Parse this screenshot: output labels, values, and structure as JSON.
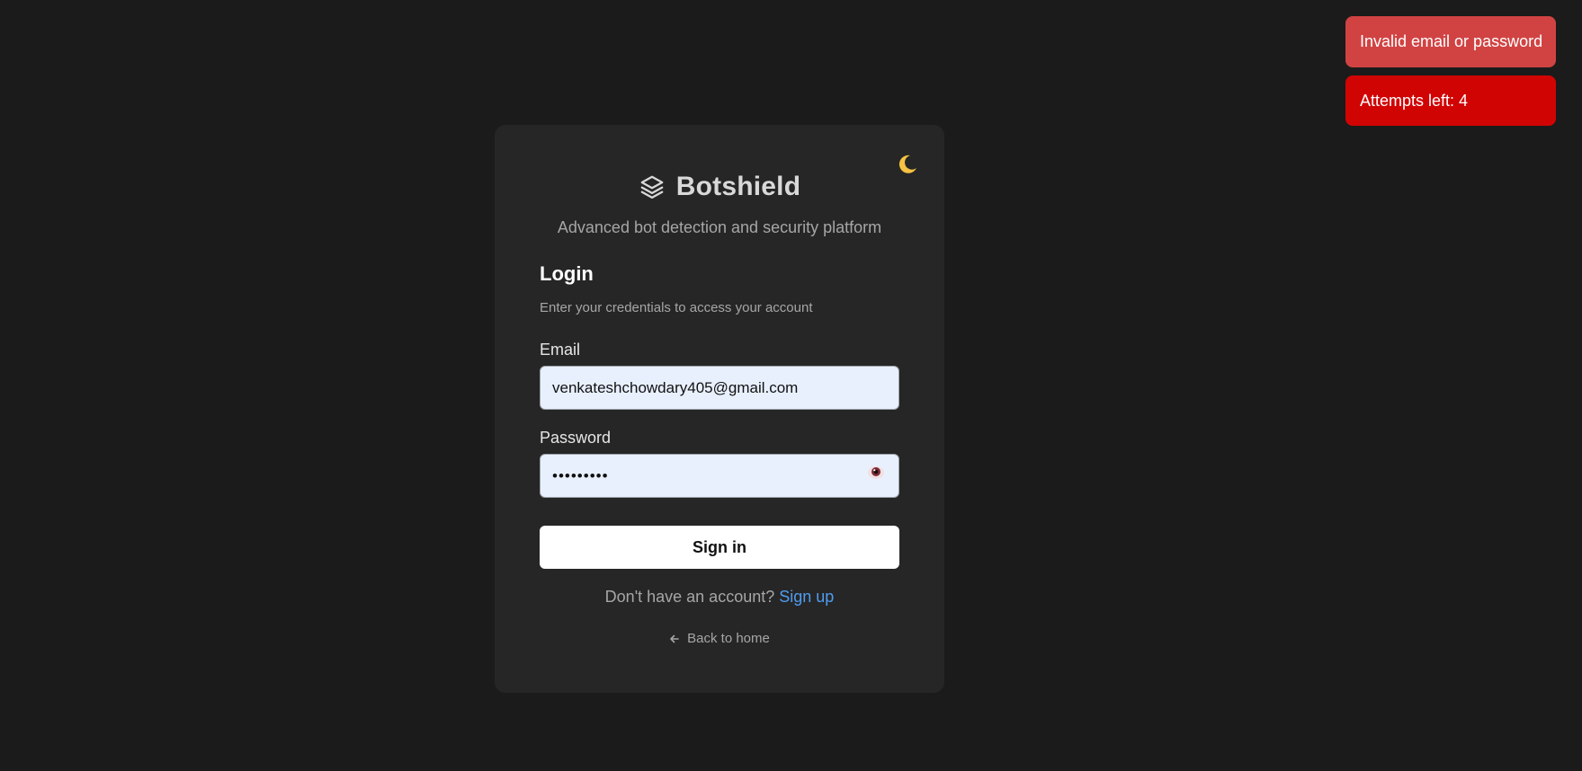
{
  "toasts": [
    {
      "message": "Invalid email or password",
      "color": "#d14343"
    },
    {
      "message": "Attempts left: 4",
      "color": "#d10404"
    }
  ],
  "brand": {
    "name": "Botshield",
    "tagline": "Advanced bot detection and security platform",
    "icon": "layers-icon"
  },
  "theme_toggle": {
    "icon": "moon-icon"
  },
  "login": {
    "title": "Login",
    "subtitle": "Enter your credentials to access your account",
    "email_label": "Email",
    "email_value": "venkateshchowdary405@gmail.com",
    "password_label": "Password",
    "password_value": "•••••••••",
    "password_toggle_icon": "eye-icon",
    "submit_label": "Sign in"
  },
  "footer": {
    "signup_prompt": "Don't have an account?",
    "signup_link": "Sign up",
    "back_label": "Back to home",
    "back_icon": "arrow-left-icon"
  },
  "colors": {
    "background": "#1b1b1b",
    "card": "#262626",
    "link": "#4f9cf0",
    "input_fill": "#e8f0fe"
  }
}
